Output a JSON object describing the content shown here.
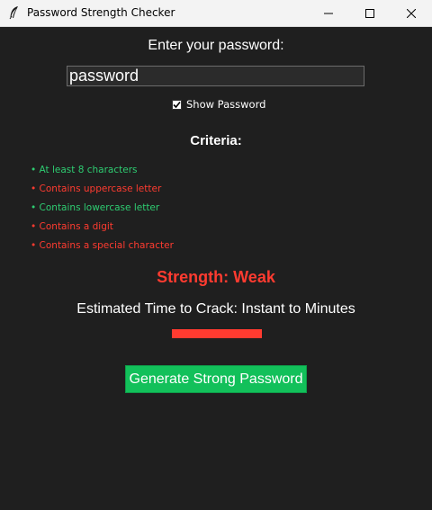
{
  "window": {
    "title": "Password Strength Checker",
    "app_icon": "feather-icon",
    "controls": [
      "minimize-icon",
      "maximize-icon",
      "close-icon"
    ]
  },
  "form": {
    "prompt": "Enter your password:",
    "password_value": "password",
    "show_password_label": "Show Password",
    "show_password_checked": true
  },
  "criteria": {
    "title": "Criteria:",
    "items": [
      {
        "label": "• At least 8 characters",
        "met": true
      },
      {
        "label": "• Contains uppercase letter",
        "met": false
      },
      {
        "label": "• Contains lowercase letter",
        "met": true
      },
      {
        "label": "• Contains a digit",
        "met": false
      },
      {
        "label": "• Contains a special character",
        "met": false
      }
    ]
  },
  "result": {
    "strength_text": "Strength: Weak",
    "crack_time_text": "Estimated Time to Crack: Instant to Minutes",
    "strength_level": 0.2
  },
  "actions": {
    "generate_label": "Generate Strong Password"
  },
  "colors": {
    "background": "#1f1f1f",
    "met": "#2ecc71",
    "unmet": "#ff3b30",
    "weak": "#ff3b30",
    "button": "#12c05a"
  }
}
